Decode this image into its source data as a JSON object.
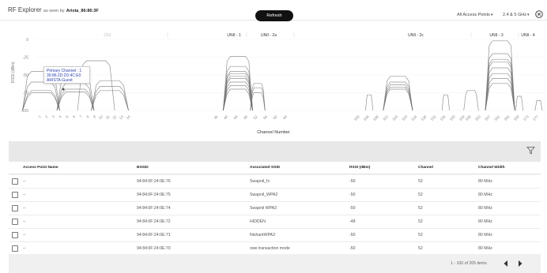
{
  "header": {
    "title": "RF Explorer",
    "subtitle": "as seen by",
    "device": "Arista_86:86:3F",
    "refresh_label": "Refresh",
    "filter_dropdown": "All Access Points",
    "band_dropdown": "2.4 & 5 GHz"
  },
  "chart": {
    "tooltip": {
      "line1": "Primary Channel : 1",
      "line2": "30:86:2D:2D:4C:E0",
      "line3": "ARISTA-Guest"
    }
  },
  "chart_data": {
    "type": "area",
    "title": "",
    "xlabel": "Channel Number",
    "ylabel": "RSSI (dBm)",
    "ylim": [
      -100,
      0
    ],
    "yticks": [
      "0",
      "-25",
      "-50",
      "-75",
      "-100"
    ],
    "band_labels": [
      "Ch1",
      "UNII - 1",
      "UNII - 2a",
      "UNII - 2c",
      "UNII - 3",
      "UNII - 4"
    ],
    "channels_24": [
      "1",
      "2",
      "3",
      "4",
      "5",
      "6",
      "7",
      "8",
      "9",
      "10",
      "11",
      "12",
      "13",
      "14"
    ],
    "channels_5": [
      "36",
      "40",
      "44",
      "48",
      "52",
      "56",
      "60",
      "64",
      "100",
      "104",
      "108",
      "112",
      "116",
      "120",
      "124",
      "128",
      "132",
      "136",
      "140",
      "144",
      "149",
      "153",
      "157",
      "161",
      "165",
      "169",
      "173",
      "177"
    ],
    "series": [
      {
        "band": "2.4",
        "center": "1",
        "width": 4,
        "rssi": -45
      },
      {
        "band": "2.4",
        "center": "1",
        "width": 4,
        "rssi": -60
      },
      {
        "band": "2.4",
        "center": "1",
        "width": 4,
        "rssi": -72
      },
      {
        "band": "2.4",
        "center": "1",
        "width": 4,
        "rssi": -75
      },
      {
        "band": "2.4",
        "center": "6",
        "width": 4,
        "rssi": -48
      },
      {
        "band": "2.4",
        "center": "6",
        "width": 4,
        "rssi": -62
      },
      {
        "band": "2.4",
        "center": "6",
        "width": 4,
        "rssi": -70
      },
      {
        "band": "2.4",
        "center": "6",
        "width": 4,
        "rssi": -74
      },
      {
        "band": "2.4",
        "center": "11",
        "width": 4,
        "rssi": -58
      },
      {
        "band": "2.4",
        "center": "11",
        "width": 4,
        "rssi": -66
      },
      {
        "band": "2.4",
        "center": "11",
        "width": 4,
        "rssi": -72
      },
      {
        "band": "2.4",
        "center": "9",
        "width": 4,
        "rssi": -30
      },
      {
        "band": "5",
        "center": "44",
        "width": 4,
        "rssi": -24
      },
      {
        "band": "5",
        "center": "44",
        "width": 4,
        "rssi": -38
      },
      {
        "band": "5",
        "center": "44",
        "width": 4,
        "rssi": -45
      },
      {
        "band": "5",
        "center": "44",
        "width": 4,
        "rssi": -48
      },
      {
        "band": "5",
        "center": "44",
        "width": 4,
        "rssi": -52
      },
      {
        "band": "5",
        "center": "44",
        "width": 4,
        "rssi": -55
      },
      {
        "band": "5",
        "center": "44",
        "width": 4,
        "rssi": -60
      },
      {
        "band": "5",
        "center": "44",
        "width": 4,
        "rssi": -65
      },
      {
        "band": "5",
        "center": "44",
        "width": 4,
        "rssi": -70
      },
      {
        "band": "5",
        "center": "52",
        "width": 2,
        "rssi": -62
      },
      {
        "band": "5",
        "center": "52",
        "width": 2,
        "rssi": -68
      },
      {
        "band": "5",
        "center": "52",
        "width": 2,
        "rssi": -75
      },
      {
        "band": "5",
        "center": "104",
        "width": 1,
        "rssi": -78
      },
      {
        "band": "5",
        "center": "116",
        "width": 4,
        "rssi": -52
      },
      {
        "band": "5",
        "center": "116",
        "width": 4,
        "rssi": -60
      },
      {
        "band": "5",
        "center": "116",
        "width": 4,
        "rssi": -64
      },
      {
        "band": "5",
        "center": "116",
        "width": 4,
        "rssi": -67
      },
      {
        "band": "5",
        "center": "116",
        "width": 4,
        "rssi": -70
      },
      {
        "band": "5",
        "center": "136",
        "width": 1,
        "rssi": -78
      },
      {
        "band": "5",
        "center": "161",
        "width": 4,
        "rssi": -2
      },
      {
        "band": "5",
        "center": "161",
        "width": 4,
        "rssi": -20
      },
      {
        "band": "5",
        "center": "161",
        "width": 4,
        "rssi": -28
      },
      {
        "band": "5",
        "center": "161",
        "width": 4,
        "rssi": -32
      },
      {
        "band": "5",
        "center": "161",
        "width": 4,
        "rssi": -40
      },
      {
        "band": "5",
        "center": "161",
        "width": 4,
        "rssi": -48
      },
      {
        "band": "5",
        "center": "161",
        "width": 4,
        "rssi": -55
      },
      {
        "band": "5",
        "center": "161",
        "width": 4,
        "rssi": -62
      },
      {
        "band": "5",
        "center": "149",
        "width": 2,
        "rssi": -72
      },
      {
        "band": "5",
        "center": "169",
        "width": 1,
        "rssi": -80
      },
      {
        "band": "5",
        "center": "177",
        "width": 1,
        "rssi": -86
      }
    ]
  },
  "table": {
    "columns": [
      "Access Point Name",
      "BSSID",
      "Associated SSID",
      "RSSI (dBm)",
      "Channel",
      "Channel Width"
    ],
    "rows": [
      [
        "--",
        "94:84:0F:24:0E:76",
        "Swapnil_fx",
        "-50",
        "52",
        "80 MHz"
      ],
      [
        "--",
        "94:84:0F:24:0E:75",
        "Swapnil_WPA2",
        "-50",
        "52",
        "80 MHz"
      ],
      [
        "--",
        "94:84:0F:24:0E:74",
        "Swapnil WPA3",
        "-50",
        "52",
        "80 MHz"
      ],
      [
        "--",
        "94:84:0F:24:0E:72",
        "HIDDEN",
        "-48",
        "52",
        "80 MHz"
      ],
      [
        "--",
        "94:84:0F:24:0E:71",
        "NishantWPA3",
        "-50",
        "52",
        "80 MHz"
      ],
      [
        "--",
        "94:84:0F:24:0E:70",
        "owe transaction mode",
        "-50",
        "52",
        "80 MHz"
      ]
    ],
    "pager_text": "1 - 100 of 205 items"
  }
}
